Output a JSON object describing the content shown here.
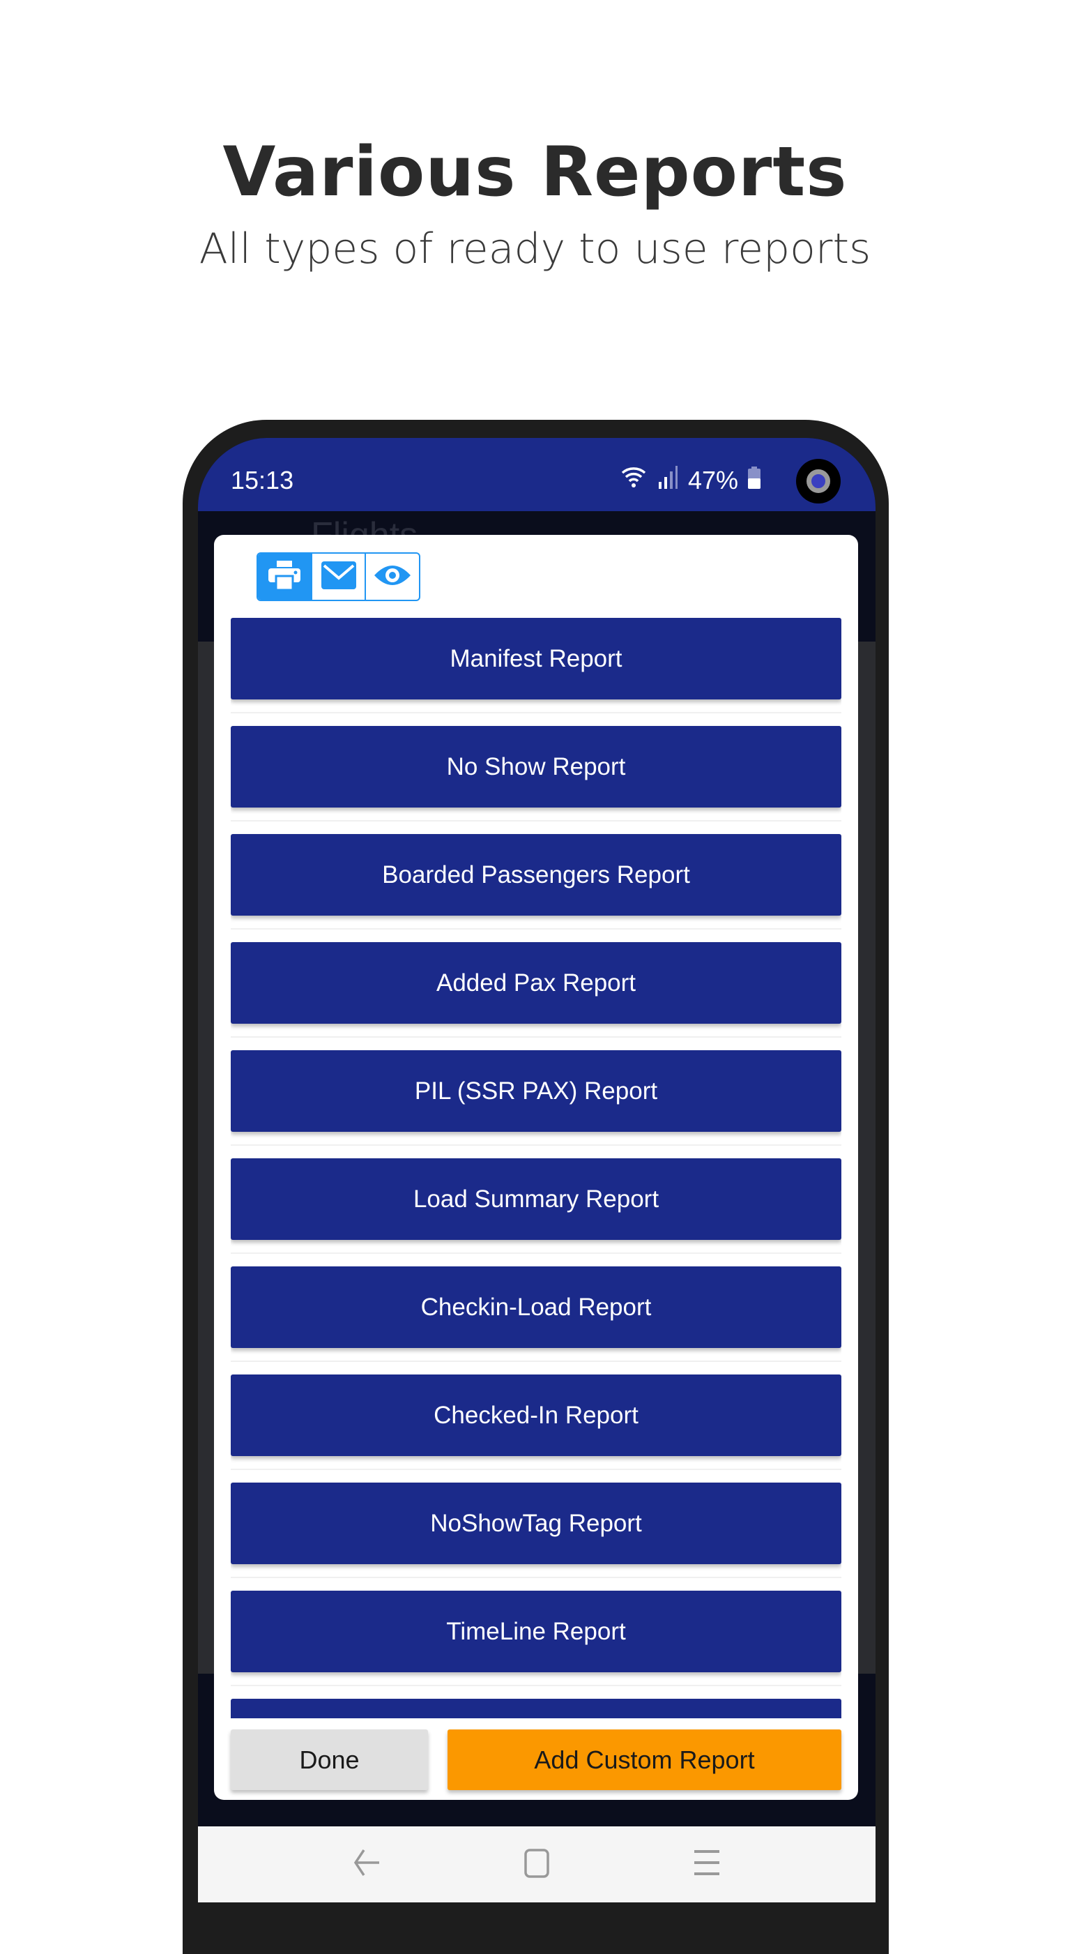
{
  "header": {
    "title": "Various Reports",
    "subtitle": "All types of ready to use reports"
  },
  "status_bar": {
    "time": "15:13",
    "battery": "47%"
  },
  "background": {
    "title": "Flights"
  },
  "toolbar": {
    "icons": [
      "printer-icon",
      "mail-icon",
      "eye-icon"
    ],
    "active": "printer-icon"
  },
  "reports": [
    "Manifest Report",
    "No Show Report",
    "Boarded Passengers Report",
    "Added Pax Report",
    "PIL (SSR PAX) Report",
    "Load Summary Report",
    "Checkin-Load Report",
    "Checked-In Report",
    "NoShowTag Report",
    "TimeLine Report",
    ""
  ],
  "actions": {
    "done": "Done",
    "add_custom": "Add Custom Report"
  },
  "colors": {
    "primary": "#1b2a8a",
    "accent": "#fb9800",
    "tool": "#2196f3"
  }
}
